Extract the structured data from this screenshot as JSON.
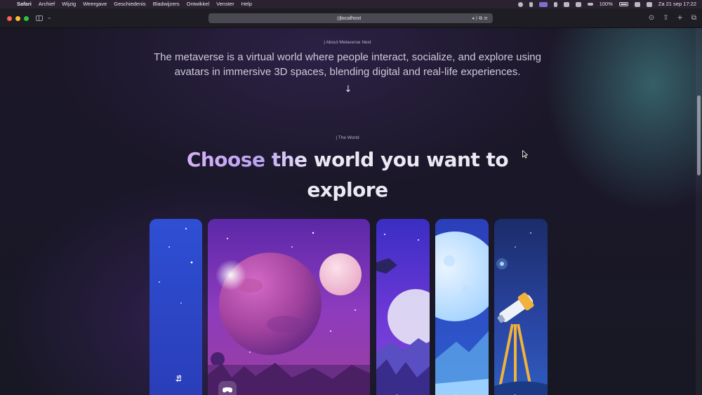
{
  "menubar": {
    "app": "Safari",
    "items": [
      "Archief",
      "Wijzig",
      "Weergave",
      "Geschiedenis",
      "Bladwijzers",
      "Ontwikkel",
      "Venster",
      "Help"
    ],
    "battery": "100%",
    "datetime": "Za 21 sep  17:22"
  },
  "browser": {
    "url": "localhost"
  },
  "about": {
    "eyebrow": "| About Metaverse Next",
    "text": "The metaverse is a virtual world where people interact, socialize, and explore using avatars in immersive 3D spaces, blending digital and real-life experiences.",
    "arrow": "↓"
  },
  "world": {
    "eyebrow": "| The World",
    "title_highlight": "Choose the",
    "title_rest": " world you want to explore"
  },
  "cards": [
    {
      "label": "ts"
    },
    {
      "label": ""
    },
    {
      "label": "·"
    },
    {
      "label": "·"
    },
    {
      "label": "·"
    }
  ],
  "colors": {
    "accent": "#c9a8f5",
    "background": "#1a1728"
  },
  "icons": {
    "apple": "apple-icon",
    "sidebar": "sidebar-icon",
    "vr": "vr-headset-icon",
    "arrow": "arrow-down-icon"
  }
}
